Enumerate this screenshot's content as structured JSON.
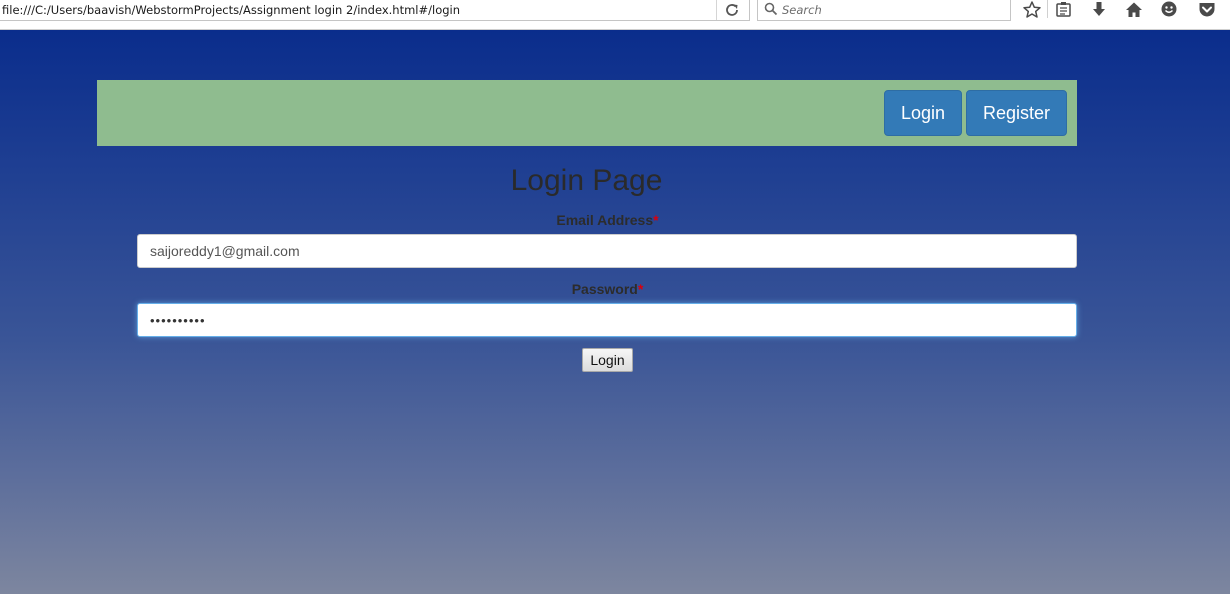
{
  "browser": {
    "url": "file:///C:/Users/baavish/WebstormProjects/Assignment login 2/index.html#/login",
    "search_placeholder": "Search"
  },
  "navbar": {
    "login_label": "Login",
    "register_label": "Register"
  },
  "form": {
    "title": "Login Page",
    "email_label": "Email Address",
    "email_value": "saijoreddy1@gmail.com",
    "password_label": "Password",
    "password_value": "••••••••••",
    "required_marker": "*",
    "submit_label": "Login"
  },
  "colors": {
    "navbar_bg": "#8fbc8f",
    "button_primary": "#337ab7",
    "background_top": "#0a2d8c",
    "background_bottom": "#7d869f",
    "required_marker": "#d9000d"
  },
  "icons": [
    "reload-icon",
    "search-icon",
    "star-icon",
    "reading-list-icon",
    "download-icon",
    "home-icon",
    "smiley-icon",
    "pocket-icon"
  ]
}
